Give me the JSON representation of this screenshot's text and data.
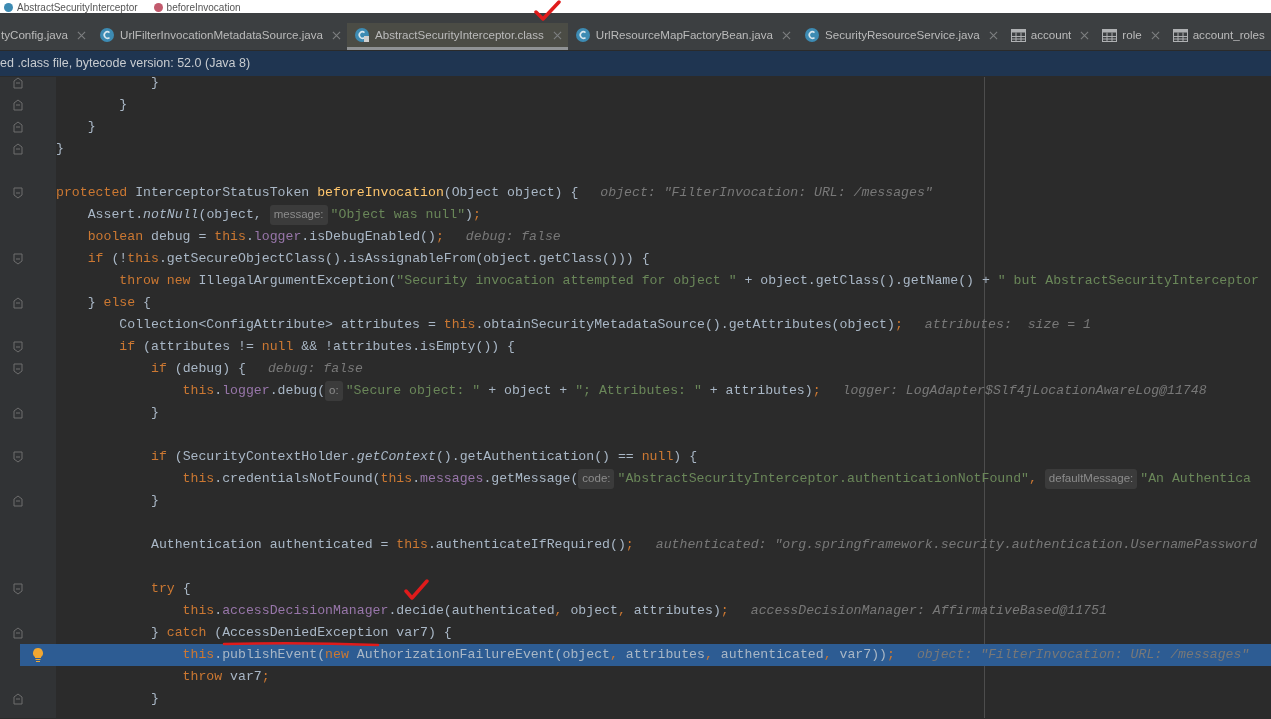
{
  "breadcrumb": [
    {
      "label": "AbstractSecurityInterceptor",
      "kind": "class"
    },
    {
      "label": "beforeInvocation",
      "kind": "method"
    }
  ],
  "tabs": [
    {
      "label": "tyConfig.java",
      "kind": "noicon",
      "selected": false,
      "closable": true
    },
    {
      "label": "UrlFilterInvocationMetadataSource.java",
      "kind": "class",
      "selected": false,
      "closable": true
    },
    {
      "label": "AbstractSecurityInterceptor.class",
      "kind": "classfile",
      "selected": true,
      "closable": true
    },
    {
      "label": "UrlResourceMapFactoryBean.java",
      "kind": "class",
      "selected": false,
      "closable": true
    },
    {
      "label": "SecurityResourceService.java",
      "kind": "class",
      "selected": false,
      "closable": true
    },
    {
      "label": "account",
      "kind": "table",
      "selected": false,
      "closable": true
    },
    {
      "label": "role",
      "kind": "table",
      "selected": false,
      "closable": true
    },
    {
      "label": "account_roles",
      "kind": "table",
      "selected": false,
      "closable": false
    }
  ],
  "info_bar": {
    "text": "ed .class file, bytecode version: 52.0 (Java 8)"
  },
  "code_lines": [
    {
      "kind": "fold-end",
      "highlighted": false,
      "tokens": [
        {
          "kind": "plain",
          "text": "            }"
        }
      ]
    },
    {
      "kind": "fold-end",
      "highlighted": false,
      "tokens": [
        {
          "kind": "plain",
          "text": "        }"
        }
      ]
    },
    {
      "kind": "fold-end",
      "highlighted": false,
      "tokens": [
        {
          "kind": "plain",
          "text": "    }"
        }
      ]
    },
    {
      "kind": "fold-end",
      "highlighted": false,
      "tokens": [
        {
          "kind": "plain",
          "text": "}"
        }
      ]
    },
    {
      "kind": "plain",
      "highlighted": false
    },
    {
      "kind": "fold-start",
      "highlighted": false,
      "tokens": [
        {
          "kind": "kw",
          "text": "protected "
        },
        {
          "kind": "plain",
          "text": "InterceptorStatusToken "
        },
        {
          "kind": "decl",
          "text": "beforeInvocation"
        },
        {
          "kind": "plain",
          "text": "(Object object) {"
        },
        {
          "kind": "value",
          "text": "object: \"FilterInvocation: URL: /messages\""
        }
      ]
    },
    {
      "kind": "plain",
      "highlighted": false,
      "tokens": [
        {
          "kind": "plain",
          "text": "    Assert."
        },
        {
          "kind": "static",
          "text": "notNull"
        },
        {
          "kind": "plain",
          "text": "(object, "
        },
        {
          "kind": "param",
          "text": "message:"
        },
        {
          "kind": "str",
          "text": "\"Object was null\""
        },
        {
          "kind": "plain",
          "text": ")"
        },
        {
          "kind": "kw",
          "text": ";"
        }
      ]
    },
    {
      "kind": "plain",
      "highlighted": false,
      "tokens": [
        {
          "kind": "kw",
          "text": "    boolean "
        },
        {
          "kind": "plain",
          "text": "debug = "
        },
        {
          "kind": "kw",
          "text": "this"
        },
        {
          "kind": "plain",
          "text": "."
        },
        {
          "kind": "field",
          "text": "logger"
        },
        {
          "kind": "plain",
          "text": ".isDebugEnabled()"
        },
        {
          "kind": "kw",
          "text": ";"
        },
        {
          "kind": "value",
          "text": "debug: false"
        }
      ]
    },
    {
      "kind": "fold-start",
      "highlighted": false,
      "tokens": [
        {
          "kind": "kw",
          "text": "    if "
        },
        {
          "kind": "plain",
          "text": "(!"
        },
        {
          "kind": "kw",
          "text": "this"
        },
        {
          "kind": "plain",
          "text": ".getSecureObjectClass().isAssignableFrom(object.getClass())) {"
        }
      ]
    },
    {
      "kind": "plain",
      "highlighted": false,
      "tokens": [
        {
          "kind": "kw",
          "text": "        throw new "
        },
        {
          "kind": "plain",
          "text": "IllegalArgumentException("
        },
        {
          "kind": "str",
          "text": "\"Security invocation attempted for object \""
        },
        {
          "kind": "plain",
          "text": " + object.getClass().getName() + "
        },
        {
          "kind": "str",
          "text": "\" but AbstractSecurityInterceptor"
        }
      ]
    },
    {
      "kind": "fold-end",
      "highlighted": false,
      "tokens": [
        {
          "kind": "plain",
          "text": "    } "
        },
        {
          "kind": "kw",
          "text": "else "
        },
        {
          "kind": "plain",
          "text": "{"
        }
      ]
    },
    {
      "kind": "plain",
      "highlighted": false,
      "tokens": [
        {
          "kind": "plain",
          "text": "        Collection<ConfigAttribute> attributes = "
        },
        {
          "kind": "kw",
          "text": "this"
        },
        {
          "kind": "plain",
          "text": ".obtainSecurityMetadataSource().getAttributes(object)"
        },
        {
          "kind": "kw",
          "text": ";"
        },
        {
          "kind": "value",
          "text": "attributes:  size = 1"
        }
      ]
    },
    {
      "kind": "fold-start",
      "highlighted": false,
      "tokens": [
        {
          "kind": "kw",
          "text": "        if "
        },
        {
          "kind": "plain",
          "text": "(attributes != "
        },
        {
          "kind": "kw",
          "text": "null "
        },
        {
          "kind": "plain",
          "text": "&& !attributes.isEmpty()) {"
        }
      ]
    },
    {
      "kind": "fold-start",
      "highlighted": false,
      "tokens": [
        {
          "kind": "kw",
          "text": "            if "
        },
        {
          "kind": "plain",
          "text": "(debug) {"
        },
        {
          "kind": "value",
          "text": "debug: false"
        }
      ]
    },
    {
      "kind": "plain",
      "highlighted": false,
      "tokens": [
        {
          "kind": "kw",
          "text": "                this"
        },
        {
          "kind": "plain",
          "text": "."
        },
        {
          "kind": "field",
          "text": "logger"
        },
        {
          "kind": "plain",
          "text": ".debug("
        },
        {
          "kind": "param",
          "text": "o:"
        },
        {
          "kind": "str",
          "text": "\"Secure object: \""
        },
        {
          "kind": "plain",
          "text": " + object + "
        },
        {
          "kind": "str",
          "text": "\"; Attributes: \""
        },
        {
          "kind": "plain",
          "text": " + attributes)"
        },
        {
          "kind": "kw",
          "text": ";"
        },
        {
          "kind": "value",
          "text": "logger: LogAdapter$Slf4jLocationAwareLog@11748"
        }
      ]
    },
    {
      "kind": "fold-end",
      "highlighted": false,
      "tokens": [
        {
          "kind": "plain",
          "text": "            }"
        }
      ]
    },
    {
      "kind": "plain",
      "highlighted": false
    },
    {
      "kind": "fold-start",
      "highlighted": false,
      "tokens": [
        {
          "kind": "kw",
          "text": "            if "
        },
        {
          "kind": "plain",
          "text": "(SecurityContextHolder."
        },
        {
          "kind": "static",
          "text": "getContext"
        },
        {
          "kind": "plain",
          "text": "().getAuthentication() == "
        },
        {
          "kind": "kw",
          "text": "null"
        },
        {
          "kind": "plain",
          "text": ") {"
        }
      ]
    },
    {
      "kind": "plain",
      "highlighted": false,
      "tokens": [
        {
          "kind": "kw",
          "text": "                this"
        },
        {
          "kind": "plain",
          "text": ".credentialsNotFound("
        },
        {
          "kind": "kw",
          "text": "this"
        },
        {
          "kind": "plain",
          "text": "."
        },
        {
          "kind": "field",
          "text": "messages"
        },
        {
          "kind": "plain",
          "text": ".getMessage("
        },
        {
          "kind": "param",
          "text": "code:"
        },
        {
          "kind": "str",
          "text": "\"AbstractSecurityInterceptor.authenticationNotFound\""
        },
        {
          "kind": "kw",
          "text": ", "
        },
        {
          "kind": "param",
          "text": "defaultMessage:"
        },
        {
          "kind": "str",
          "text": "\"An Authentica"
        }
      ]
    },
    {
      "kind": "fold-end",
      "highlighted": false,
      "tokens": [
        {
          "kind": "plain",
          "text": "            }"
        }
      ]
    },
    {
      "kind": "plain",
      "highlighted": false
    },
    {
      "kind": "plain",
      "highlighted": false,
      "tokens": [
        {
          "kind": "plain",
          "text": "            Authentication authenticated = "
        },
        {
          "kind": "kw",
          "text": "this"
        },
        {
          "kind": "plain",
          "text": ".authenticateIfRequired()"
        },
        {
          "kind": "kw",
          "text": ";"
        },
        {
          "kind": "value",
          "text": "authenticated: \"org.springframework.security.authentication.UsernamePassword"
        }
      ]
    },
    {
      "kind": "plain",
      "highlighted": false
    },
    {
      "kind": "fold-start",
      "highlighted": false,
      "tokens": [
        {
          "kind": "kw",
          "text": "            try "
        },
        {
          "kind": "plain",
          "text": "{"
        }
      ]
    },
    {
      "kind": "plain",
      "highlighted": false,
      "tokens": [
        {
          "kind": "kw",
          "text": "                this"
        },
        {
          "kind": "plain",
          "text": "."
        },
        {
          "kind": "field",
          "text": "accessDecisionManager"
        },
        {
          "kind": "plain",
          "text": ".decide(authenticated"
        },
        {
          "kind": "kw",
          "text": ", "
        },
        {
          "kind": "plain",
          "text": "object"
        },
        {
          "kind": "kw",
          "text": ", "
        },
        {
          "kind": "plain",
          "text": "attributes)"
        },
        {
          "kind": "kw",
          "text": ";"
        },
        {
          "kind": "value",
          "text": "accessDecisionManager: AffirmativeBased@11751"
        }
      ]
    },
    {
      "kind": "fold-end",
      "highlighted": false,
      "tokens": [
        {
          "kind": "plain",
          "text": "            } "
        },
        {
          "kind": "kw",
          "text": "catch "
        },
        {
          "kind": "plain",
          "text": "(AccessDeniedException var7) {"
        }
      ]
    },
    {
      "kind": "plain",
      "highlighted": true,
      "tokens": [
        {
          "kind": "kw",
          "text": "                this"
        },
        {
          "kind": "plain",
          "text": ".publishEvent("
        },
        {
          "kind": "kw",
          "text": "new "
        },
        {
          "kind": "plain",
          "text": "AuthorizationFailureEvent(object"
        },
        {
          "kind": "kw",
          "text": ", "
        },
        {
          "kind": "plain",
          "text": "attributes"
        },
        {
          "kind": "kw",
          "text": ", "
        },
        {
          "kind": "plain",
          "text": "authenticated"
        },
        {
          "kind": "kw",
          "text": ", "
        },
        {
          "kind": "plain",
          "text": "var7))"
        },
        {
          "kind": "kw",
          "text": ";"
        },
        {
          "kind": "value",
          "text": "object: \"FilterInvocation: URL: /messages\""
        }
      ]
    },
    {
      "kind": "plain",
      "highlighted": false,
      "tokens": [
        {
          "kind": "kw",
          "text": "                throw "
        },
        {
          "kind": "plain",
          "text": "var7"
        },
        {
          "kind": "kw",
          "text": ";"
        }
      ]
    },
    {
      "kind": "fold-end",
      "highlighted": false,
      "tokens": [
        {
          "kind": "plain",
          "text": "            }"
        }
      ]
    }
  ]
}
